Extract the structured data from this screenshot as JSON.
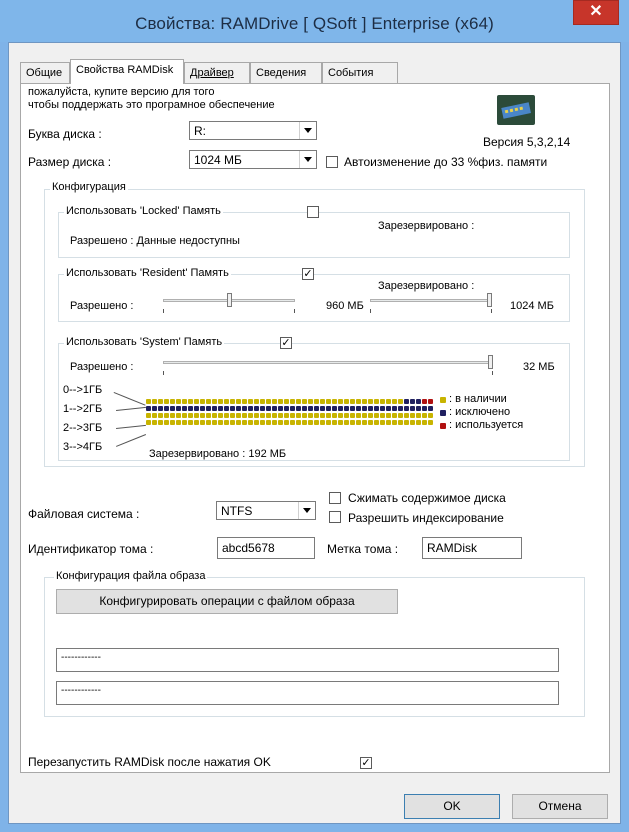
{
  "window": {
    "title": "Свойства: RAMDrive [ QSoft ] Enterprise (x64)",
    "close_symbol": "✕"
  },
  "tabs": [
    "Общие",
    "Свойства RAMDisk",
    "Драйвер",
    "Сведения",
    "События"
  ],
  "info": {
    "line1": "пожалуйста, купите версию для того",
    "line2": "чтобы поддержать это програмное обеспечение",
    "version": "Версия 5,3,2,14"
  },
  "drive": {
    "letter_label": "Буква диска :",
    "letter_value": "R:",
    "size_label": "Размер диска :",
    "size_value": "1024 МБ",
    "autosize_label": "Автоизменение до",
    "autosize_percent": "33",
    "autosize_suffix": "%физ. памяти"
  },
  "config": {
    "label": "Конфигурация",
    "locked": {
      "label": "Использовать 'Locked' Память",
      "checked": "",
      "reserved_label": "Зарезервировано :",
      "allowed_text": "Разрешено : Данные недоступны"
    },
    "resident": {
      "label": "Использовать 'Resident' Память",
      "checked": "✓",
      "reserved_label": "Зарезервировано :",
      "allowed_label": "Разрешено :",
      "allowed_value": "960 МБ",
      "reserved_value": "1024 МБ",
      "allowed_fraction": 0.5,
      "reserved_fraction": 1.0
    },
    "system": {
      "label": "Использовать 'System' Память",
      "checked": "✓",
      "allowed_label": "Разрешено :",
      "allowed_value": "32 МБ",
      "allowed_fraction": 1.0
    },
    "map": {
      "ranges": [
        "0-->1ГБ",
        "1-->2ГБ",
        "2-->3ГБ",
        "3-->4ГБ"
      ],
      "reserved_text": "Зарезервировано :   192 МБ",
      "legend": [
        {
          "label": ": в наличии",
          "color": "#c8b400"
        },
        {
          "label": ": исключено",
          "color": "#202060"
        },
        {
          "label": ": используется",
          "color": "#b01010"
        }
      ],
      "rows": [
        [
          "a",
          "a",
          "a",
          "a",
          "a",
          "a",
          "a",
          "a",
          "a",
          "a",
          "a",
          "a",
          "a",
          "a",
          "a",
          "a",
          "a",
          "a",
          "a",
          "a",
          "a",
          "a",
          "a",
          "a",
          "a",
          "a",
          "a",
          "a",
          "a",
          "a",
          "a",
          "a",
          "a",
          "a",
          "a",
          "a",
          "a",
          "a",
          "a",
          "a",
          "a",
          "a",
          "a",
          "x",
          "x",
          "x",
          "u",
          "u"
        ],
        [
          "x",
          "x",
          "x",
          "x",
          "x",
          "x",
          "x",
          "x",
          "x",
          "x",
          "x",
          "x",
          "x",
          "x",
          "x",
          "x",
          "x",
          "x",
          "x",
          "x",
          "x",
          "x",
          "x",
          "x",
          "x",
          "x",
          "x",
          "x",
          "x",
          "x",
          "x",
          "x",
          "x",
          "x",
          "x",
          "x",
          "x",
          "x",
          "x",
          "x",
          "x",
          "x",
          "x",
          "x",
          "x",
          "x",
          "x",
          "x"
        ],
        [
          "a",
          "a",
          "a",
          "a",
          "a",
          "a",
          "a",
          "a",
          "a",
          "a",
          "a",
          "a",
          "a",
          "a",
          "a",
          "a",
          "a",
          "a",
          "a",
          "a",
          "a",
          "a",
          "a",
          "a",
          "a",
          "a",
          "a",
          "a",
          "a",
          "a",
          "a",
          "a",
          "a",
          "a",
          "a",
          "a",
          "a",
          "a",
          "a",
          "a",
          "a",
          "a",
          "a",
          "a",
          "a",
          "a",
          "a",
          "a"
        ],
        [
          "a",
          "a",
          "a",
          "a",
          "a",
          "a",
          "a",
          "a",
          "a",
          "a",
          "a",
          "a",
          "a",
          "a",
          "a",
          "a",
          "a",
          "a",
          "a",
          "a",
          "a",
          "a",
          "a",
          "a",
          "a",
          "a",
          "a",
          "a",
          "a",
          "a",
          "a",
          "a",
          "a",
          "a",
          "a",
          "a",
          "a",
          "a",
          "a",
          "a",
          "a",
          "a",
          "a",
          "a",
          "a",
          "a",
          "a",
          "a"
        ]
      ]
    }
  },
  "filesystem": {
    "label": "Файловая система :",
    "value": "NTFS",
    "compress_label": "Сжимать содержимое диска",
    "index_label": "Разрешить индексирование"
  },
  "volume": {
    "id_label": "Идентификатор тома :",
    "id_value": "abcd5678",
    "name_label": "Метка тома :",
    "name_value": "RAMDisk"
  },
  "image": {
    "group_label": "Конфигурация файла образа",
    "button_label": "Конфигурировать операции с файлом образа",
    "field1": "------------",
    "field2": "------------"
  },
  "restart": {
    "label": "Перезапустить RAMDisk после нажатия OK",
    "checked": "✓"
  },
  "buttons": {
    "ok": "OK",
    "cancel": "Отмена"
  }
}
